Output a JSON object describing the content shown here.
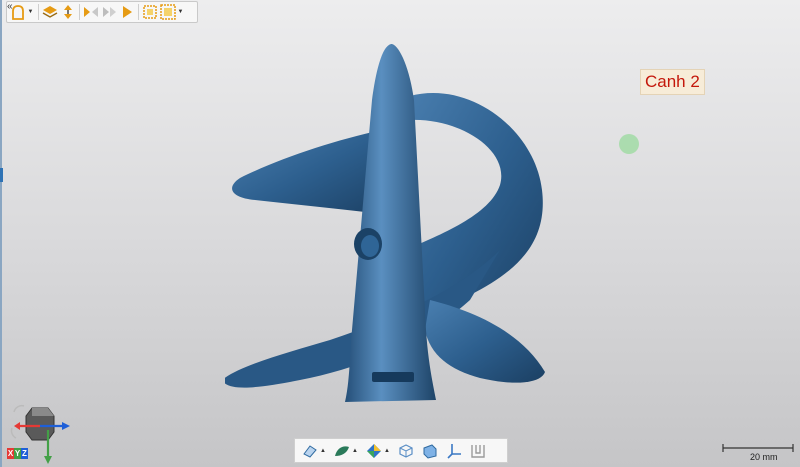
{
  "viewport": {
    "annotation_label": "Canh 2",
    "scale_label": "20 mm",
    "model_name": "propeller-auger-mesh"
  },
  "toolbar": {
    "collapse_glyph": "«",
    "buttons": [
      {
        "icon": "selection-shape-icon"
      },
      {
        "icon": "layers-icon"
      },
      {
        "icon": "move-icon"
      },
      {
        "icon": "flip-icon"
      },
      {
        "icon": "reverse-icon"
      },
      {
        "icon": "play-icon"
      },
      {
        "icon": "select-region-icon"
      },
      {
        "icon": "select-all-icon"
      }
    ]
  },
  "bottom_toolbar": {
    "buttons": [
      {
        "icon": "render-mode-icon"
      },
      {
        "icon": "mesh-display-icon"
      },
      {
        "icon": "color-display-icon"
      },
      {
        "icon": "box-view-icon"
      },
      {
        "icon": "plane-view-icon"
      },
      {
        "icon": "axis-view-icon"
      },
      {
        "icon": "section-view-icon"
      }
    ]
  },
  "gizmo": {
    "axis_letters": [
      "X",
      "Y",
      "Z"
    ],
    "colors": {
      "x": "#e53935",
      "y": "#43a047",
      "z": "#1e5fd8"
    }
  },
  "colors": {
    "model": "#2d5f8e",
    "annotation_text": "#c4180c",
    "annotation_bg": "#f7ecd8",
    "marker": "#a5dba8",
    "toolbar_accent": "#f0a020"
  }
}
